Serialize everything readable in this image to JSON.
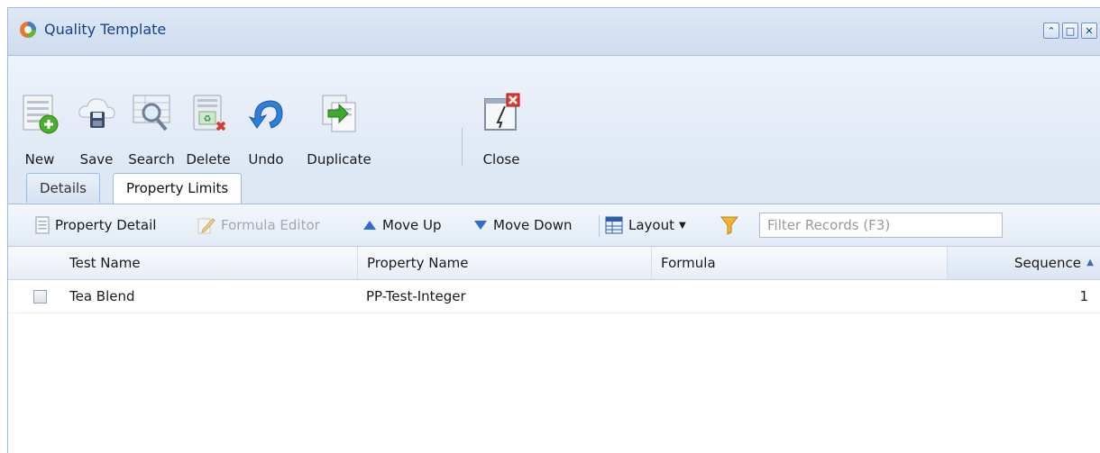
{
  "window": {
    "title": "Quality Template"
  },
  "toolbar": {
    "new_label": "New",
    "save_label": "Save",
    "search_label": "Search",
    "delete_label": "Delete",
    "undo_label": "Undo",
    "duplicate_label": "Duplicate",
    "close_label": "Close"
  },
  "tabs": {
    "details": "Details",
    "property_limits": "Property Limits",
    "active": "Property Limits"
  },
  "grid_toolbar": {
    "property_detail": "Property Detail",
    "formula_editor": "Formula Editor",
    "move_up": "Move Up",
    "move_down": "Move Down",
    "layout": "Layout",
    "filter_placeholder": "Filter Records (F3)"
  },
  "grid": {
    "columns": {
      "test_name": "Test Name",
      "property_name": "Property Name",
      "formula": "Formula",
      "sequence": "Sequence"
    },
    "sorted_column": "Sequence",
    "rows": [
      {
        "test_name": "Tea Blend",
        "property_name": "PP-Test-Integer",
        "formula": "",
        "sequence": "1"
      }
    ]
  },
  "colors": {
    "accent": "#15428b",
    "panel": "#dfe8f6",
    "border": "#99bbe8"
  }
}
